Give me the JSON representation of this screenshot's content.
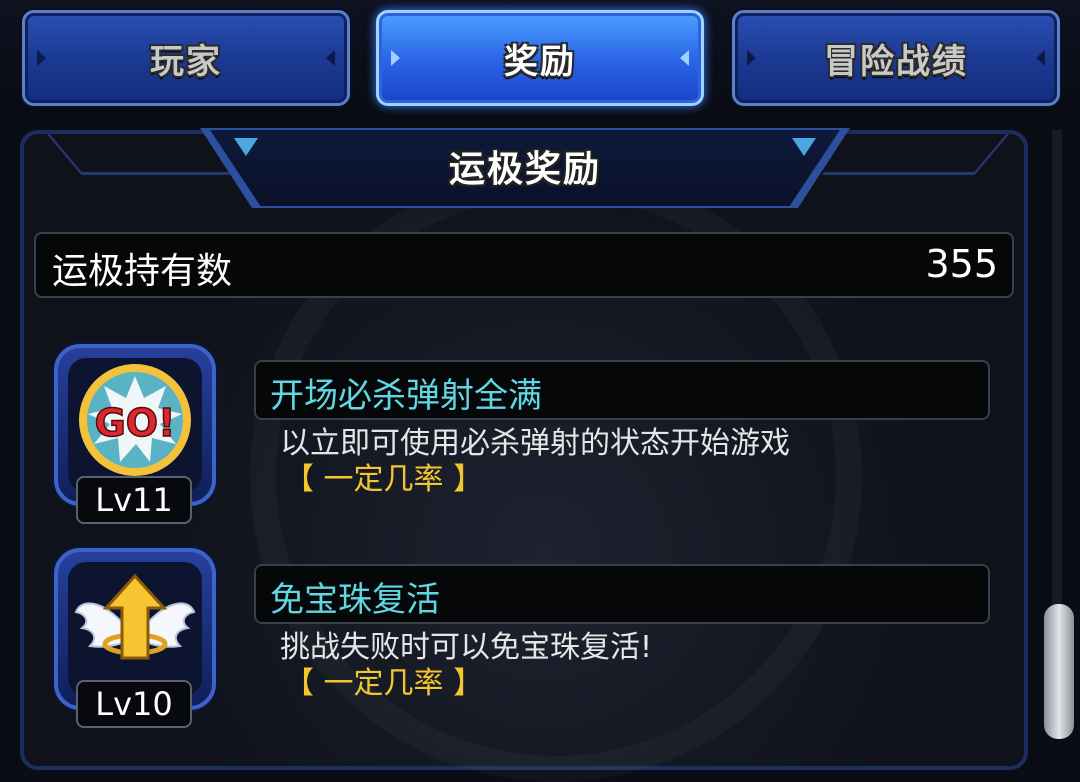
{
  "tabs": [
    {
      "label": "玩家",
      "active": false
    },
    {
      "label": "奖励",
      "active": true
    },
    {
      "label": "冒险战绩",
      "active": false
    }
  ],
  "section": {
    "title": "运极奖励"
  },
  "luck": {
    "label": "运极持有数",
    "value": "355"
  },
  "rewards": [
    {
      "icon": "go-burst-icon",
      "level": "Lv11",
      "name": "开场必杀弹射全满",
      "description": "以立即可使用必杀弹射的状态开始游戏",
      "chance": "【 一定几率 】"
    },
    {
      "icon": "winged-arrow-icon",
      "level": "Lv10",
      "name": "免宝珠复活",
      "description": "挑战失败时可以免宝珠复活!",
      "chance": "【 一定几率 】"
    }
  ],
  "colors": {
    "tab_active": "#2a62e6",
    "tab_inactive": "#1b3a93",
    "reward_name": "#5fd8e4",
    "chance": "#f3c62d"
  }
}
